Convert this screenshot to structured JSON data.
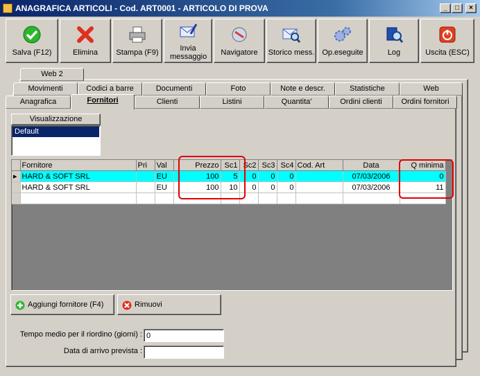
{
  "window": {
    "title": "ANAGRAFICA ARTICOLI - Cod. ART0001 - ARTICOLO DI PROVA"
  },
  "toolbar": [
    {
      "label": "Salva (F12)",
      "icon": "check-icon",
      "color": "#2db52d"
    },
    {
      "label": "Elimina",
      "icon": "x-icon",
      "color": "#e03020"
    },
    {
      "label": "Stampa (F9)",
      "icon": "printer-icon",
      "color": "#808080"
    },
    {
      "label": "Invia messaggio",
      "icon": "envelope-pen-icon",
      "color": "#3050c0"
    },
    {
      "label": "Navigatore",
      "icon": "compass-icon",
      "color": "#d04040"
    },
    {
      "label": "Storico mess.",
      "icon": "envelope-search-icon",
      "color": "#4060c0"
    },
    {
      "label": "Op.eseguite",
      "icon": "gears-icon",
      "color": "#5070c0"
    },
    {
      "label": "Log",
      "icon": "book-search-icon",
      "color": "#2050b0"
    },
    {
      "label": "Uscita (ESC)",
      "icon": "power-icon",
      "color": "#e04020"
    }
  ],
  "tabs_row1": [
    "Web 2"
  ],
  "tabs_row2": [
    "Movimenti",
    "Codici a barre",
    "Documenti",
    "Foto",
    "Note e descr.",
    "Statistiche",
    "Web"
  ],
  "tabs_row3": [
    "Anagrafica",
    "Fornitori",
    "Clienti",
    "Listini",
    "Quantita'",
    "Ordini clienti",
    "Ordini fornitori"
  ],
  "active_tab": "Fornitori",
  "view": {
    "label": "Visualizzazione",
    "options": [
      "Default"
    ],
    "selected": "Default"
  },
  "grid": {
    "columns": [
      "Fornitore",
      "Pri",
      "Val",
      "Prezzo",
      "Sc1",
      "Sc2",
      "Sc3",
      "Sc4",
      "Cod. Art",
      "Data",
      "Q minima"
    ],
    "rows": [
      [
        "HARD & SOFT SRL",
        "",
        "EU",
        "100",
        "5",
        "0",
        "0",
        "0",
        "",
        "07/03/2006",
        "0"
      ],
      [
        "HARD & SOFT SRL",
        "",
        "EU",
        "100",
        "10",
        "0",
        "0",
        "0",
        "",
        "07/03/2006",
        "11"
      ]
    ]
  },
  "buttons": {
    "add": "Aggiungi fornitore (F4)",
    "remove": "Rimuovi"
  },
  "fields": {
    "tempo_label": "Tempo medio per il riordino (giorni) :",
    "tempo_value": "0",
    "data_label": "Data di arrivo prevista :",
    "data_value": ""
  }
}
